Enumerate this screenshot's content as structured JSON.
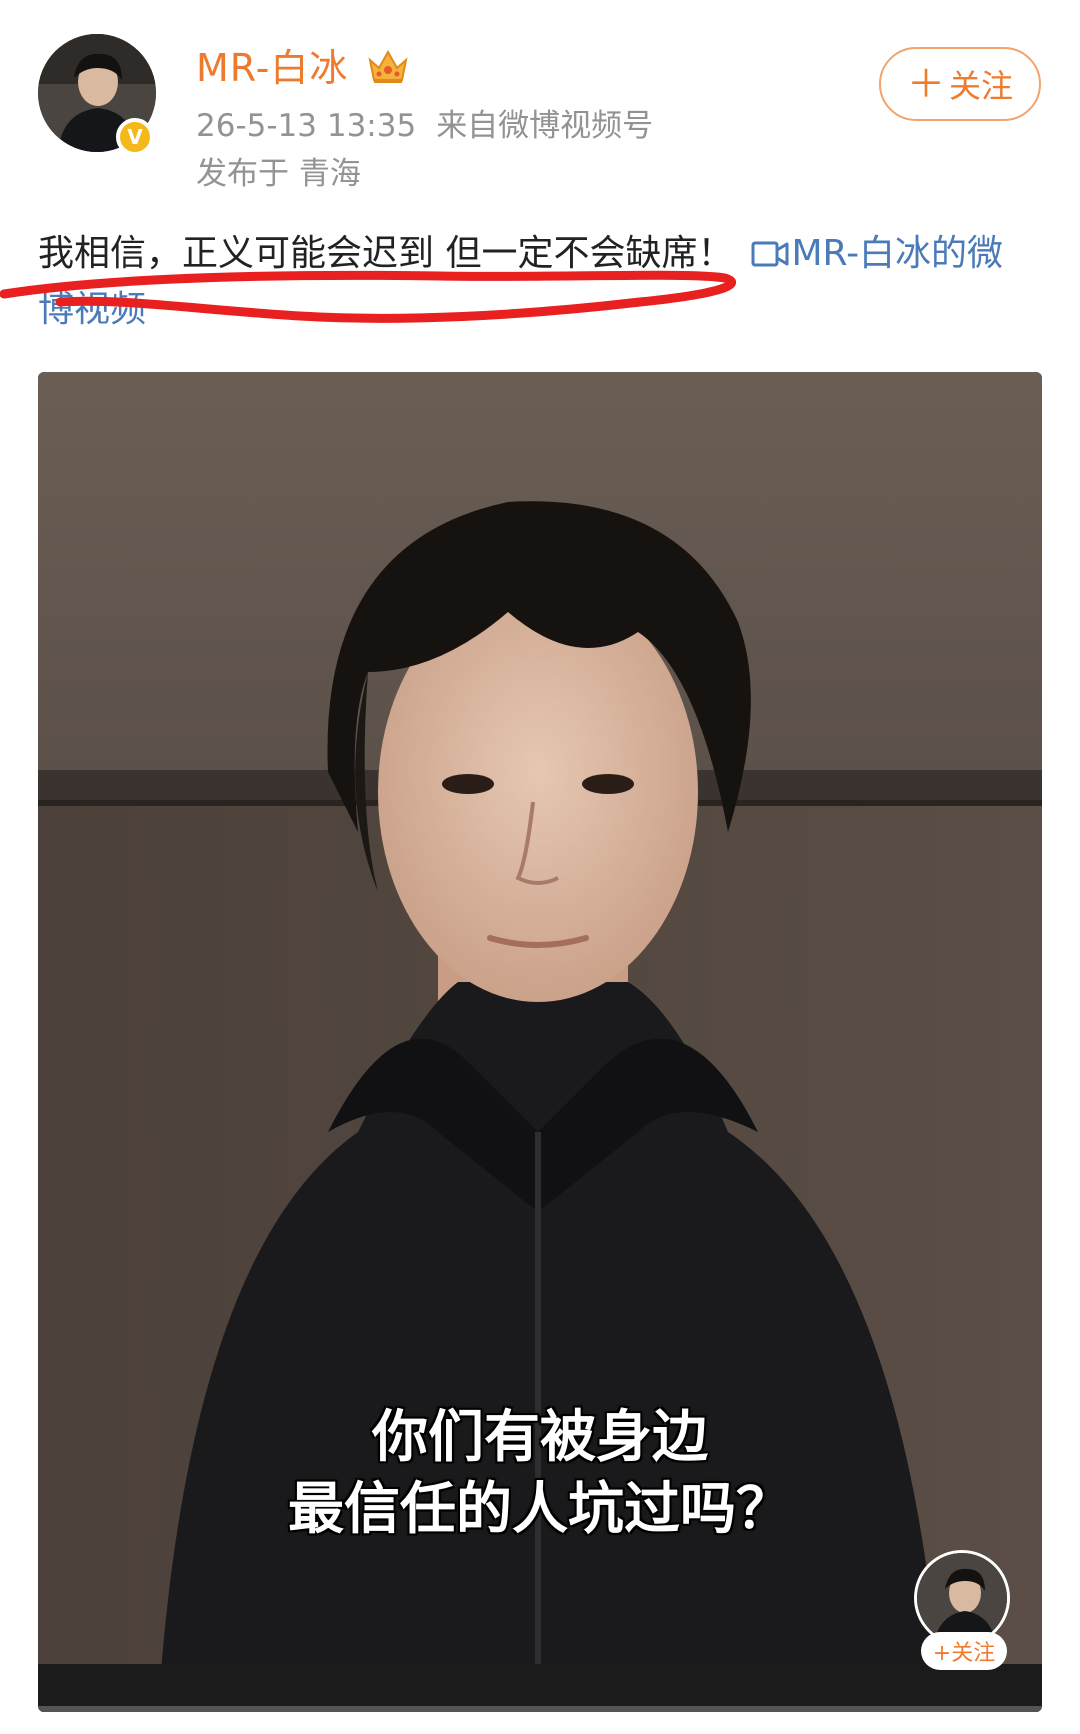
{
  "author": {
    "name": "MR-白冰",
    "avatar_icon": "user-avatar",
    "verified_icon": "verified-badge-icon",
    "verified_mark": "V",
    "crown_icon": "crown-icon"
  },
  "post_meta": {
    "time": "26-5-13 13:35",
    "source": "来自微博视频号",
    "location": "发布于 青海"
  },
  "follow_button": {
    "plus": "＋",
    "label": "关注"
  },
  "post": {
    "text": "我相信，正义可能会迟到 但一定不会缺席！",
    "video_link_icon": "video-icon",
    "video_link": "MR-白冰的微博视频"
  },
  "video": {
    "subtitle_line1": "你们有被身边",
    "subtitle_line2": "最信任的人坑过吗？",
    "mini_follow_label": "+关注"
  },
  "colors": {
    "username": "#ee7a2d",
    "meta_text": "#939393",
    "link": "#4a7bb8",
    "annotation_underline": "#e8201f"
  }
}
